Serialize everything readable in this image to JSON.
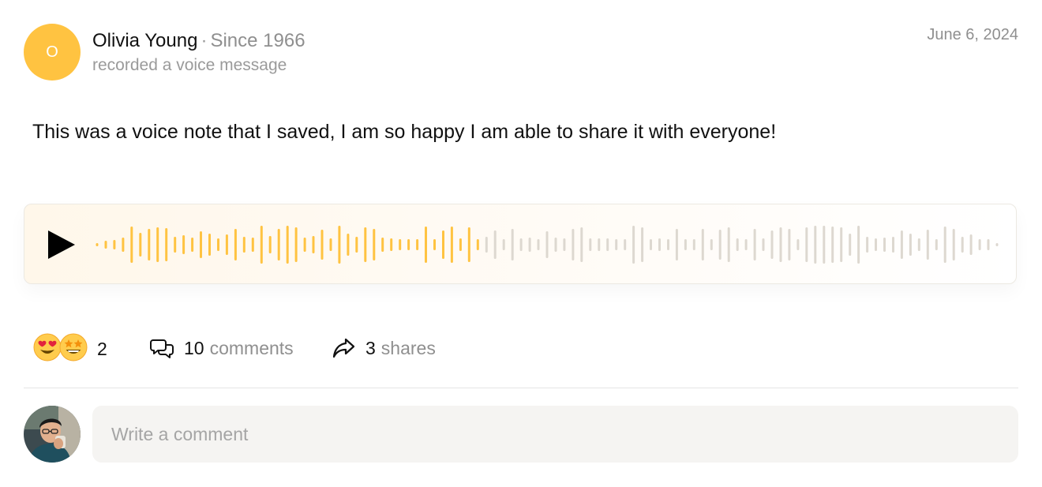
{
  "post": {
    "author_initial": "O",
    "author_name": "Olivia Young",
    "separator": "·",
    "since": "Since 1966",
    "action": "recorded a voice message",
    "date": "June 6, 2024",
    "text": "This was a voice note that I saved, I am so happy I am able to share it with everyone!"
  },
  "audio": {
    "play_icon": "play-icon",
    "progress_fraction": 0.43,
    "played_color": "#FFC341",
    "unplayed_color": "#DDD8D0"
  },
  "stats": {
    "reaction_icons": [
      "heart-eyes-emoji",
      "star-struck-emoji"
    ],
    "reactions_count": "2",
    "comments_count": "10",
    "comments_word": "comments",
    "shares_count": "3",
    "shares_word": "shares"
  },
  "comment_input": {
    "placeholder": "Write a comment"
  },
  "colors": {
    "accent": "#FFC341",
    "muted_text": "#8F8F8F",
    "input_bg": "#F5F4F2"
  }
}
